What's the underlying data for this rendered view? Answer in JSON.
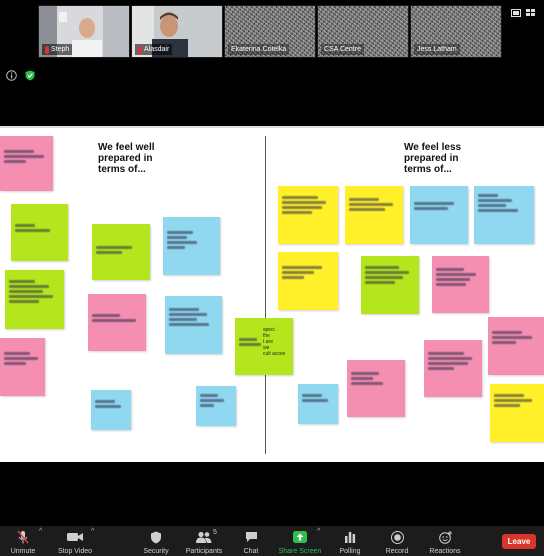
{
  "participants_strip": {
    "tiles": [
      {
        "name": "Steph"
      },
      {
        "name": "Alasdair"
      },
      {
        "name": "Ekaterina Cotelka"
      },
      {
        "name": "CSA Centre"
      },
      {
        "name": "Jess Latham"
      }
    ]
  },
  "share": {
    "heading_left": "We feel well\nprepared in\nterms of...",
    "heading_right": "We feel less\nprepared in\nterms of...",
    "partial_note_text": "speci\nthe\nt are\nwe\ncult acces"
  },
  "toolbar": {
    "unmute": "Unmute",
    "stop_video": "Stop Video",
    "security": "Security",
    "participants": "Participants",
    "participants_count": "5",
    "chat": "Chat",
    "share_screen": "Share Screen",
    "polling": "Polling",
    "record": "Record",
    "reactions": "Reactions",
    "leave": "Leave"
  },
  "colors": {
    "sticky_pink": "#f48fb1",
    "sticky_green": "#b5e61d",
    "sticky_blue": "#8fd8ef",
    "sticky_yellow": "#fff02a",
    "leave_red": "#d9362b",
    "share_green": "#2dbe4e"
  }
}
